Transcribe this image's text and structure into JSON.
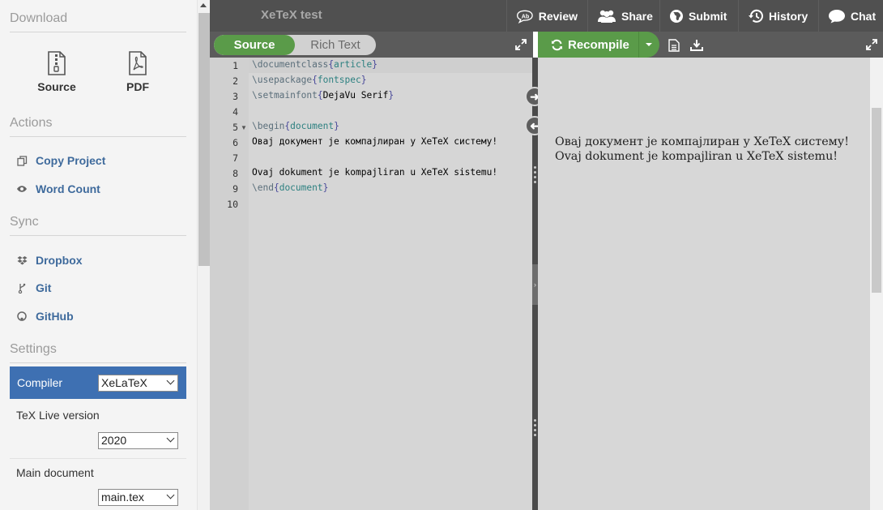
{
  "left_panel": {
    "download": {
      "heading": "Download",
      "items": [
        {
          "label": "Source",
          "icon": "zip-file-icon"
        },
        {
          "label": "PDF",
          "icon": "pdf-file-icon"
        }
      ]
    },
    "actions": {
      "heading": "Actions",
      "items": [
        {
          "label": "Copy Project",
          "icon": "copy-icon"
        },
        {
          "label": "Word Count",
          "icon": "eye-icon"
        }
      ]
    },
    "sync": {
      "heading": "Sync",
      "items": [
        {
          "label": "Dropbox",
          "icon": "dropbox-icon"
        },
        {
          "label": "Git",
          "icon": "git-icon"
        },
        {
          "label": "GitHub",
          "icon": "github-icon"
        }
      ]
    },
    "settings": {
      "heading": "Settings",
      "compiler": {
        "label": "Compiler",
        "value": "XeLaTeX"
      },
      "texlive": {
        "label": "TeX Live version",
        "value": "2020"
      },
      "main_document": {
        "label": "Main document",
        "value": "main.tex"
      }
    }
  },
  "toolbar": {
    "project_title": "XeTeX test",
    "buttons": [
      {
        "label": "Review",
        "icon": "review-icon"
      },
      {
        "label": "Share",
        "icon": "share-icon"
      },
      {
        "label": "Submit",
        "icon": "globe-icon"
      },
      {
        "label": "History",
        "icon": "history-icon"
      },
      {
        "label": "Chat",
        "icon": "chat-icon"
      }
    ]
  },
  "editor_toolbar": {
    "source_label": "Source",
    "rich_text_label": "Rich Text"
  },
  "pdf_toolbar": {
    "recompile_label": "Recompile"
  },
  "editor": {
    "line_numbers": [
      "1",
      "2",
      "3",
      "4",
      "5",
      "6",
      "7",
      "8",
      "9",
      "10"
    ],
    "lines": [
      {
        "cmd": "\\documentclass",
        "open": "{",
        "arg": "article",
        "close": "}",
        "text": ""
      },
      {
        "cmd": "\\usepackage",
        "open": "{",
        "arg": "fontspec",
        "close": "}",
        "text": ""
      },
      {
        "cmd": "\\setmainfont",
        "open": "{",
        "arg": "DejaVu Serif",
        "close": "}",
        "text": ""
      },
      {
        "cmd": "",
        "open": "",
        "arg": "",
        "close": "",
        "text": ""
      },
      {
        "cmd": "\\begin",
        "open": "{",
        "arg": "document",
        "close": "}",
        "text": ""
      },
      {
        "cmd": "",
        "open": "",
        "arg": "",
        "close": "",
        "text": "Овај документ је компајлиран у XeTeX систему!"
      },
      {
        "cmd": "",
        "open": "",
        "arg": "",
        "close": "",
        "text": ""
      },
      {
        "cmd": "",
        "open": "",
        "arg": "",
        "close": "",
        "text": "Ovaj dokument je kompajliran u XeTeX sistemu!"
      },
      {
        "cmd": "\\end",
        "open": "{",
        "arg": "document",
        "close": "}",
        "text": ""
      },
      {
        "cmd": "",
        "open": "",
        "arg": "",
        "close": "",
        "text": ""
      }
    ]
  },
  "pdf_preview": {
    "lines": [
      "Овај документ је компајлиран у XeTeX систему!",
      "Ovaj dokument je kompajliran u XeTeX sistemu!"
    ]
  }
}
